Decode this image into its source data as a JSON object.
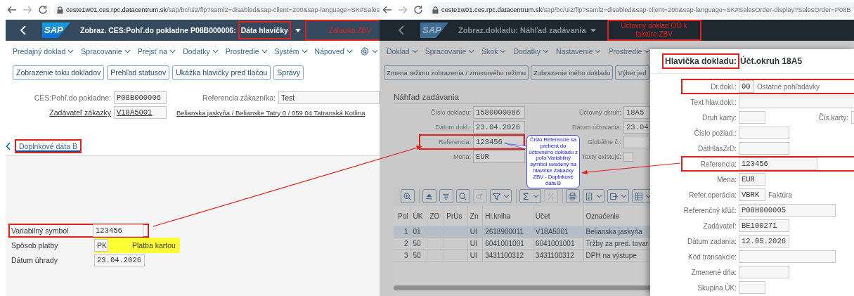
{
  "left_window": {
    "url": {
      "host": "ceste1w01.ces.rpc.datacentrum.sk",
      "path": "/sap/bc/ui2/flp?saml2=disabled&sap-client=200&sap-language=SK#Sales"
    },
    "header": {
      "logo": "SAP",
      "title": "Zobraz. CES:Pohľ.do pokladne P08B000006:",
      "subtitle": "Dáta hlavičky",
      "subtitle_boxed": true,
      "annotation": "Zákazka ZBV"
    },
    "menu": [
      "Predajný doklad",
      "Spracovanie",
      "Prejsť na",
      "Dodatky",
      "Prostredie",
      "Systém",
      "Nápoveď"
    ],
    "buttons": [
      "Zobrazenie toku dokladov",
      "Prehľad statusov",
      "Ukážka hlavičky pred tlačou",
      "Správy"
    ],
    "order_fields": [
      {
        "label": "CES:Pohľ.do pokladne:",
        "value": "P08B000006",
        "link": false
      },
      {
        "label": "Referencia zákazníka:",
        "value": "Test",
        "link": false
      },
      {
        "label": "Zadávateľ zákazky",
        "value": "V18A5001",
        "link": true
      }
    ],
    "customer_address": "Belianska jaskyňa / Belianske Tatry 0 / 059 04 Tatranská Kotlina",
    "tabs": [
      {
        "label": "Doplnkové dáta B",
        "selected": true,
        "boxed": true
      }
    ],
    "payment_fields": [
      {
        "label": "Variabilný symbol",
        "value": "123456",
        "boxed": true,
        "highlighted": false
      },
      {
        "label": "Spôsob platby",
        "value": "PK",
        "description": "Platba kartou",
        "boxed": false,
        "highlighted": true
      },
      {
        "label": "Dátum úhrady",
        "value": "23.04.2026",
        "boxed": false,
        "highlighted": false
      }
    ]
  },
  "right_window": {
    "url": {
      "host": "ceste1w01.ces.rpc.datacentrum.sk",
      "path": "/sap/bc/ui2/flp?saml2=disabled&sap-client=200&sap-language=SK#SalesOrder-display?SalesOrder=P08B"
    },
    "header": {
      "logo": "SAP",
      "title": "Zobraz.dokladu: Náhľad zadávania",
      "annotation": "Účtovný doklad OO k faktúre ZBV"
    },
    "menu": [
      "Doklad",
      "Spracovanie",
      "Skok",
      "Dodatky",
      "Nastavenie",
      "Prostredie"
    ],
    "buttons": [
      "Zmena režimu zobrazenia / zmenového režimu",
      "Zobrazenie iného dokladu",
      "Výber jed"
    ],
    "section_title": "Náhľad zadávania",
    "fields": [
      {
        "label": "Číslo dokladu:",
        "value": "1580000086",
        "kind": "input",
        "boxed": false
      },
      {
        "label": "Účtovný okruh:",
        "value": "18A5",
        "kind": "input",
        "boxed": false
      },
      {
        "label": "Dátum dokl.:",
        "value": "23.04.2026",
        "kind": "input",
        "boxed": false
      },
      {
        "label": "Dátum účtovania:",
        "value": "23.04",
        "kind": "input",
        "boxed": false
      },
      {
        "label": "Referencia:",
        "value": "123456",
        "kind": "input",
        "boxed": true
      },
      {
        "label": "Globálne č.:",
        "kind": "input",
        "boxed": false
      },
      {
        "label": "Mena:",
        "value": "EUR",
        "kind": "input",
        "boxed": false
      },
      {
        "label": "Texty existujú:",
        "kind": "checkbox",
        "checked": false,
        "boxed": false
      }
    ],
    "callout": "Číslo Referencie sa preberá do účtovného dokladu z poľa Variabilný symbol uvedený na hlavičke Zákazky ZBV - Doplnkové dáta B",
    "toolbar_groups": [
      {
        "tools": [
          {
            "kind": "zoom",
            "disabled": false
          }
        ]
      },
      {
        "tools": [
          {
            "kind": "sort-ascending",
            "disabled": false
          },
          {
            "kind": "sort-descending",
            "disabled": false
          },
          {
            "kind": "search",
            "disabled": false
          },
          {
            "kind": "find-next",
            "disabled": true
          },
          {
            "kind": "filter",
            "disabled": false
          }
        ]
      },
      {
        "tools": [
          {
            "kind": "sum",
            "disabled": false
          },
          {
            "kind": "subtotal",
            "disabled": true
          }
        ]
      },
      {
        "tools": [
          {
            "kind": "print",
            "disabled": false
          },
          {
            "kind": "export",
            "disabled": false
          },
          {
            "kind": "import",
            "disabled": false
          },
          {
            "kind": "layout",
            "disabled": false
          }
        ]
      }
    ],
    "table": {
      "columns": [
        "Pol",
        "ÚK",
        "ZO",
        "PrÚs",
        "Zn",
        "Hl.kniha",
        "Účet",
        "Označenie"
      ],
      "rows": [
        {
          "cells": [
            "1",
            "01",
            "",
            "",
            "UI",
            "2618900011",
            "V18A5001",
            "Belianska jaskyňa"
          ],
          "selected": true
        },
        {
          "cells": [
            "2",
            "50",
            "",
            "",
            "UI",
            "6041001001",
            "6041001001",
            "Tržby za pred. tovar"
          ],
          "selected": false
        },
        {
          "cells": [
            "3",
            "50",
            "",
            "",
            "UI",
            "3431100312",
            "3431100312",
            "DPH na výstupe"
          ],
          "selected": false
        }
      ]
    }
  },
  "dialog": {
    "title": "Hlavička dokladu:",
    "title_boxed": true,
    "subtitle": "Účt.okruh 18A5",
    "fields": [
      {
        "label": "Dr.dokl.:",
        "value": "00",
        "kind": "tiny",
        "note": "Ostatné pohľadávky",
        "boxed": true
      },
      {
        "label": "Text hlav.dokl.:",
        "kind": "full",
        "boxed": false
      },
      {
        "label": "Druh karty:",
        "kind": "short",
        "side_label": "Čís.karty:",
        "boxed": false
      },
      {
        "label": "Číslo požiad.:",
        "kind": "medium",
        "boxed": false
      },
      {
        "label": "DátHlásZrD:",
        "kind": "medium",
        "boxed": false
      },
      {
        "label": "Referencia:",
        "value": "123456",
        "kind": "long",
        "boxed": true
      },
      {
        "label": "Mena:",
        "value": "EUR",
        "kind": "short",
        "boxed": false
      },
      {
        "label": "Refer.operácia:",
        "value": "VBRK",
        "kind": "short",
        "note": "Faktúra",
        "boxed": false
      },
      {
        "label": "Referenčný kľúč:",
        "value": "P08H000005",
        "kind": "wide",
        "boxed": false
      },
      {
        "label": "Zadávateľ:",
        "value": "BE100271",
        "kind": "medium",
        "boxed": false
      },
      {
        "label": "Dátum zadania:",
        "value": "12.05.2026",
        "kind": "medium",
        "boxed": false
      },
      {
        "label": "Kód transakcie:",
        "kind": "wide",
        "boxed": false
      },
      {
        "label": "Zmenené dňa:",
        "kind": "medium",
        "boxed": false
      },
      {
        "label": "Skupina ÚK:",
        "kind": "short",
        "boxed": false
      }
    ]
  }
}
